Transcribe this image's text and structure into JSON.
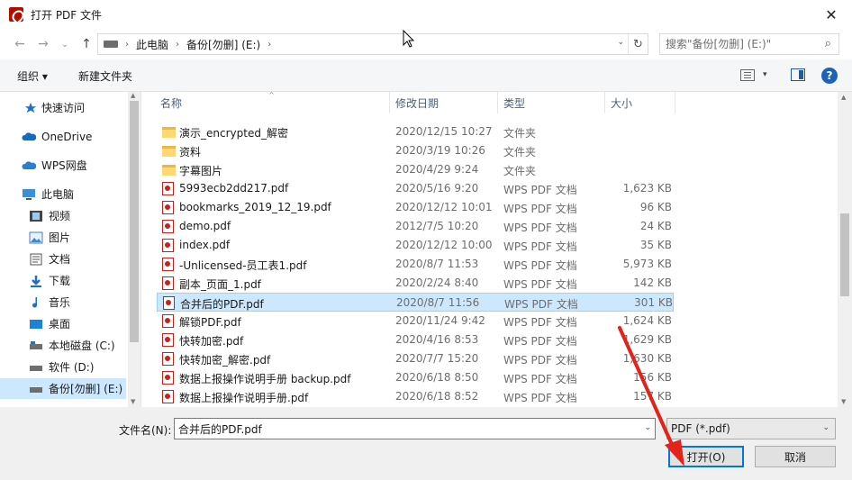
{
  "window": {
    "title": "打开 PDF 文件",
    "close_glyph": "✕"
  },
  "address": {
    "back": "←",
    "forward": "→",
    "recent": "⌄",
    "up": "↑",
    "crumbs": [
      "此电脑",
      "备份[勿删] (E:)"
    ],
    "sep": "›",
    "dropdown": "⌄",
    "refresh": "↻"
  },
  "search": {
    "placeholder": "搜索\"备份[勿删] (E:)\"",
    "icon": "⌕"
  },
  "toolbar": {
    "organize": "组织 ▾",
    "new_folder": "新建文件夹",
    "view_dd": "▾",
    "help": "?"
  },
  "nav": {
    "items": [
      {
        "label": "快速访问",
        "icon": "star-icon"
      },
      {
        "label": "OneDrive",
        "icon": "cloud-icon"
      },
      {
        "label": "WPS网盘",
        "icon": "cloud-icon"
      },
      {
        "label": "此电脑",
        "icon": "computer-icon"
      },
      {
        "label": "视频",
        "icon": "video-icon"
      },
      {
        "label": "图片",
        "icon": "picture-icon"
      },
      {
        "label": "文档",
        "icon": "document-icon"
      },
      {
        "label": "下载",
        "icon": "download-icon"
      },
      {
        "label": "音乐",
        "icon": "music-icon"
      },
      {
        "label": "桌面",
        "icon": "desktop-icon"
      },
      {
        "label": "本地磁盘 (C:)",
        "icon": "drive-icon"
      },
      {
        "label": "软件 (D:)",
        "icon": "drive-icon"
      },
      {
        "label": "备份[勿删] (E:)",
        "icon": "drive-icon"
      }
    ]
  },
  "columns": {
    "name": "名称",
    "date": "修改日期",
    "type": "类型",
    "size": "大小",
    "sort_glyph": "^"
  },
  "files": [
    {
      "name": "演示_encrypted_解密",
      "date": "2020/12/15 10:27",
      "type": "文件夹",
      "size": "",
      "kind": "folder"
    },
    {
      "name": "资料",
      "date": "2020/3/19 10:26",
      "type": "文件夹",
      "size": "",
      "kind": "folder"
    },
    {
      "name": "字幕图片",
      "date": "2020/4/29 9:24",
      "type": "文件夹",
      "size": "",
      "kind": "folder"
    },
    {
      "name": "5993ecb2dd217.pdf",
      "date": "2020/5/16 9:20",
      "type": "WPS PDF 文档",
      "size": "1,623 KB",
      "kind": "pdf"
    },
    {
      "name": "bookmarks_2019_12_19.pdf",
      "date": "2020/12/12 10:01",
      "type": "WPS PDF 文档",
      "size": "96 KB",
      "kind": "pdf"
    },
    {
      "name": "demo.pdf",
      "date": "2012/7/5 10:20",
      "type": "WPS PDF 文档",
      "size": "24 KB",
      "kind": "pdf"
    },
    {
      "name": "index.pdf",
      "date": "2020/12/12 10:00",
      "type": "WPS PDF 文档",
      "size": "35 KB",
      "kind": "pdf"
    },
    {
      "name": "-Unlicensed-员工表1.pdf",
      "date": "2020/8/7 11:53",
      "type": "WPS PDF 文档",
      "size": "5,973 KB",
      "kind": "pdf"
    },
    {
      "name": "副本_页面_1.pdf",
      "date": "2020/2/24 8:40",
      "type": "WPS PDF 文档",
      "size": "142 KB",
      "kind": "pdf"
    },
    {
      "name": "合并后的PDF.pdf",
      "date": "2020/8/7 11:56",
      "type": "WPS PDF 文档",
      "size": "301 KB",
      "kind": "pdf",
      "selected": true
    },
    {
      "name": "解锁PDF.pdf",
      "date": "2020/11/24 9:42",
      "type": "WPS PDF 文档",
      "size": "1,624 KB",
      "kind": "pdf"
    },
    {
      "name": "快转加密.pdf",
      "date": "2020/4/16 8:53",
      "type": "WPS PDF 文档",
      "size": "1,629 KB",
      "kind": "pdf"
    },
    {
      "name": "快转加密_解密.pdf",
      "date": "2020/7/7 15:20",
      "type": "WPS PDF 文档",
      "size": "1,630 KB",
      "kind": "pdf"
    },
    {
      "name": "数据上报操作说明手册 backup.pdf",
      "date": "2020/6/18 8:50",
      "type": "WPS PDF 文档",
      "size": "156 KB",
      "kind": "pdf"
    },
    {
      "name": "数据上报操作说明手册.pdf",
      "date": "2020/6/18 8:52",
      "type": "WPS PDF 文档",
      "size": "157 KB",
      "kind": "pdf"
    }
  ],
  "bottom": {
    "filename_label": "文件名(N):",
    "filename_value": "合并后的PDF.pdf",
    "filter": "PDF (*.pdf)",
    "open": "打开(O)",
    "cancel": "取消",
    "dd": "⌄"
  },
  "scroll": {
    "up": "▲",
    "down": "▼"
  },
  "colors": {
    "selection": "#cce8ff",
    "accent": "#0078d7",
    "arrow": "#e0231b"
  }
}
